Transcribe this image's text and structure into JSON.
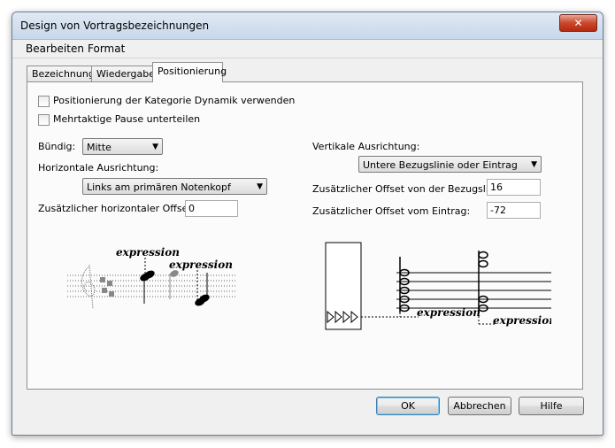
{
  "window": {
    "title": "Design von Vortragsbezeichnungen",
    "close_glyph": "✕"
  },
  "menu": [
    {
      "label": "Bearbeiten"
    },
    {
      "label": "Format"
    }
  ],
  "tabs": [
    {
      "label": "Bezeichnung",
      "active": false
    },
    {
      "label": "Wiedergabe",
      "active": false
    },
    {
      "label": "Positionierung",
      "active": true
    }
  ],
  "options": {
    "use_category_positioning": {
      "label": "Positionierung der Kategorie Dynamik verwenden",
      "checked": false
    },
    "split_multibar_rest": {
      "label": "Mehrtaktige Pause unterteilen",
      "checked": false
    }
  },
  "left": {
    "alignment": {
      "label": "Bündig:",
      "value": "Mitte"
    },
    "horizontal": {
      "label": "Horizontale Ausrichtung:",
      "value": "Links am primären Notenkopf"
    },
    "h_offset": {
      "label": "Zusätzlicher horizontaler Offset:",
      "value": "0"
    }
  },
  "right": {
    "vertical": {
      "label": "Vertikale Ausrichtung:",
      "value": "Untere Bezugslinie oder Eintrag"
    },
    "baseline_offset": {
      "label": "Zusätzlicher Offset von der Bezugslinie:",
      "value": "16"
    },
    "entry_offset": {
      "label": "Zusätzlicher Offset vom Eintrag:",
      "value": "-72"
    }
  },
  "preview": {
    "expression_text": "expression"
  },
  "buttons": {
    "ok": "OK",
    "cancel": "Abbrechen",
    "help": "Hilfe"
  },
  "icons": {
    "dropdown": "▼"
  }
}
